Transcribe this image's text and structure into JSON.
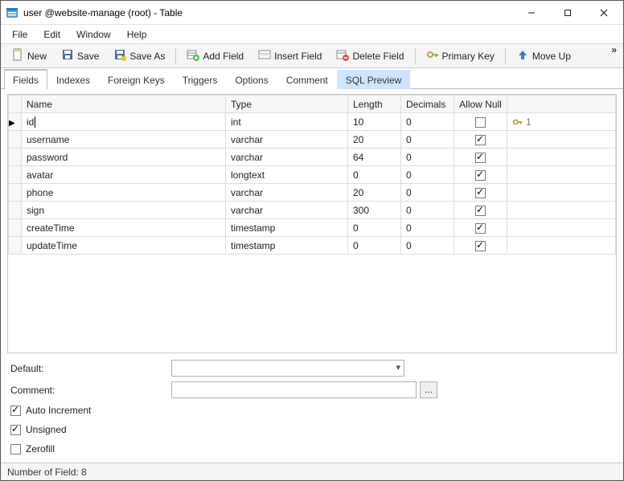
{
  "window": {
    "title": "user @website-manage (root) - Table"
  },
  "menu": {
    "items": [
      "File",
      "Edit",
      "Window",
      "Help"
    ]
  },
  "toolbar": {
    "new": "New",
    "save": "Save",
    "save_as": "Save As",
    "add_field": "Add Field",
    "insert_field": "Insert Field",
    "delete_field": "Delete Field",
    "primary_key": "Primary Key",
    "move_up": "Move Up"
  },
  "tabs": {
    "items": [
      "Fields",
      "Indexes",
      "Foreign Keys",
      "Triggers",
      "Options",
      "Comment",
      "SQL Preview"
    ],
    "active": 0,
    "highlight": 6
  },
  "grid": {
    "headers": [
      "Name",
      "Type",
      "Length",
      "Decimals",
      "Allow Null",
      ""
    ],
    "rows": [
      {
        "name": "id",
        "type": "int",
        "length": "10",
        "decimals": "0",
        "allow_null": false,
        "key": "1",
        "current": true
      },
      {
        "name": "username",
        "type": "varchar",
        "length": "20",
        "decimals": "0",
        "allow_null": true,
        "key": ""
      },
      {
        "name": "password",
        "type": "varchar",
        "length": "64",
        "decimals": "0",
        "allow_null": true,
        "key": ""
      },
      {
        "name": "avatar",
        "type": "longtext",
        "length": "0",
        "decimals": "0",
        "allow_null": true,
        "key": ""
      },
      {
        "name": "phone",
        "type": "varchar",
        "length": "20",
        "decimals": "0",
        "allow_null": true,
        "key": ""
      },
      {
        "name": "sign",
        "type": "varchar",
        "length": "300",
        "decimals": "0",
        "allow_null": true,
        "key": ""
      },
      {
        "name": "createTime",
        "type": "timestamp",
        "length": "0",
        "decimals": "0",
        "allow_null": true,
        "key": ""
      },
      {
        "name": "updateTime",
        "type": "timestamp",
        "length": "0",
        "decimals": "0",
        "allow_null": true,
        "key": ""
      }
    ]
  },
  "props": {
    "default_label": "Default:",
    "comment_label": "Comment:",
    "auto_increment_label": "Auto Increment",
    "auto_increment": true,
    "unsigned_label": "Unsigned",
    "unsigned": true,
    "zerofill_label": "Zerofill",
    "zerofill": false
  },
  "status": {
    "text": "Number of Field: 8"
  }
}
